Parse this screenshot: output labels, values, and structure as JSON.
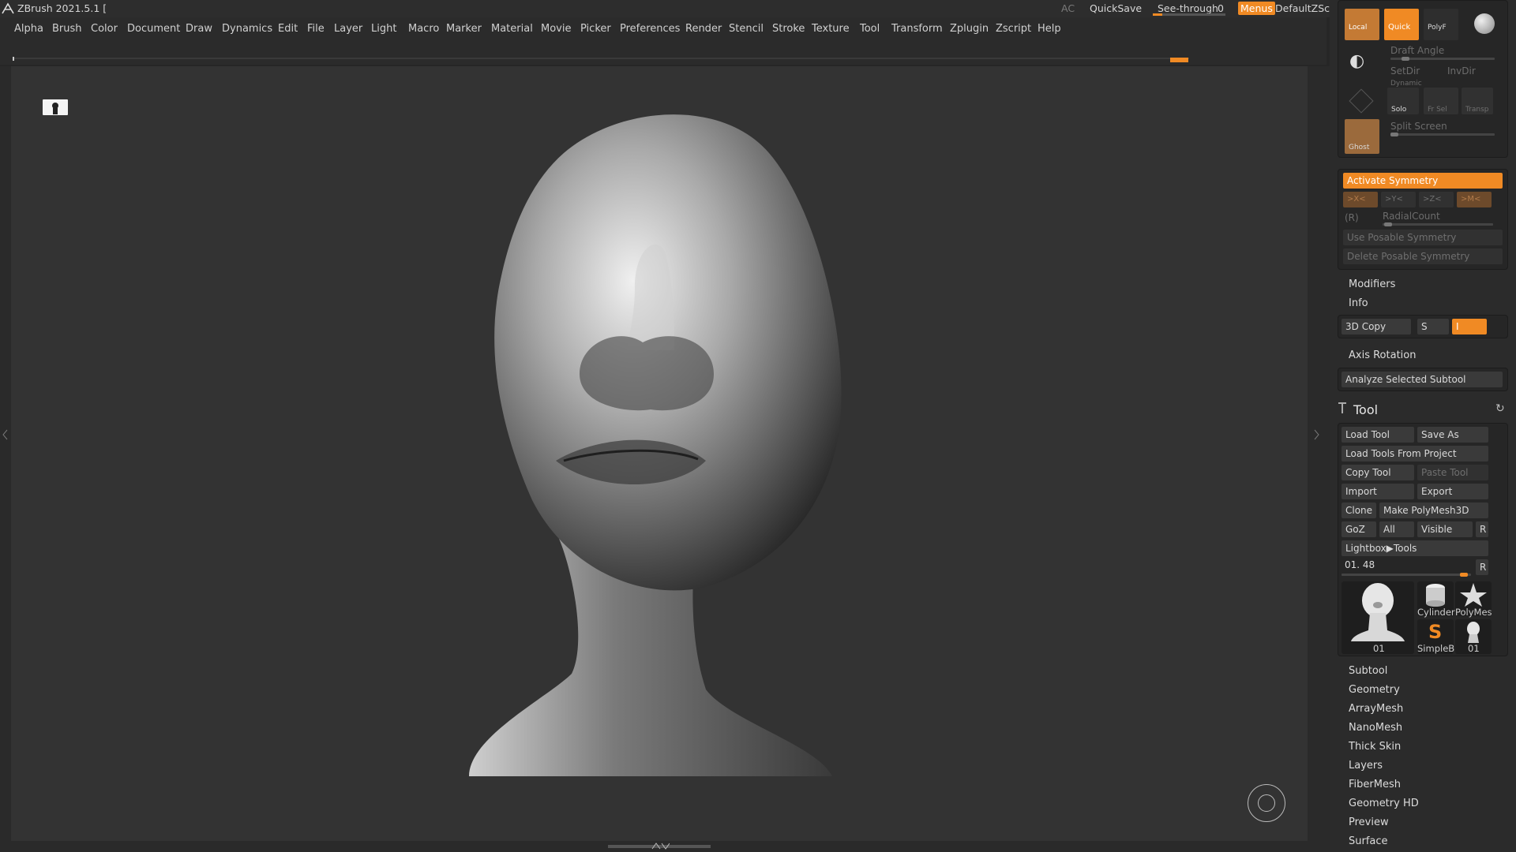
{
  "app": {
    "title": "ZBrush 2021.5.1 [",
    "ac": "AC",
    "quicksave": "QuickSave",
    "see_through_label": "See-through",
    "see_through_value": "0",
    "menus": "Menus",
    "script": "DefaultZScript"
  },
  "menu": [
    "Alpha",
    "Brush",
    "Color",
    "Document",
    "Draw",
    "Dynamics",
    "Edit",
    "File",
    "Layer",
    "Light",
    "Macro",
    "Marker",
    "Material",
    "Movie",
    "Picker",
    "Preferences",
    "Render",
    "Stencil",
    "Stroke",
    "Texture",
    "Tool",
    "Transform",
    "Zplugin",
    "Zscript",
    "Help"
  ],
  "top_buttons": {
    "local": "Local",
    "quick": "Quick",
    "polyf": "PolyF",
    "draft_angle": "Draft Angle",
    "setdir": "SetDir",
    "invdir": "InvDir",
    "dynamic": "Dynamic",
    "solo": "Solo",
    "frsel": "Fr Sel",
    "transp": "Transp",
    "split_screen": "Split Screen",
    "ghost": "Ghost"
  },
  "symmetry": {
    "activate": "Activate Symmetry",
    "x": ">X<",
    "y": ">Y<",
    "z": ">Z<",
    "m": ">M<",
    "r": "(R)",
    "radial": "RadialCount",
    "posable": "Use Posable Symmetry",
    "delete_posable": "Delete Posable Symmetry",
    "modifiers": "Modifiers",
    "info": "Info",
    "copy3d": "3D Copy",
    "s": "S",
    "i": "I",
    "axis_rotation": "Axis Rotation",
    "analyze": "Analyze Selected Subtool"
  },
  "tool": {
    "title": "Tool",
    "load_tool": "Load Tool",
    "save_as": "Save As",
    "load_from_project": "Load Tools From Project",
    "copy_tool": "Copy Tool",
    "paste_tool": "Paste Tool",
    "import": "Import",
    "export": "Export",
    "clone": "Clone",
    "make_polymesh": "Make PolyMesh3D",
    "goz": "GoZ",
    "all": "All",
    "visible": "Visible",
    "r": "R",
    "lightbox": "Lightbox▶Tools",
    "slider_value": "01. 48",
    "thumbs": {
      "main": "01",
      "cylinder": "Cylinder",
      "polymesh": "PolyMes",
      "simpleb": "SimpleB",
      "small": "01"
    }
  },
  "sections": [
    "Subtool",
    "Geometry",
    "ArrayMesh",
    "NanoMesh",
    "Thick Skin",
    "Layers",
    "FiberMesh",
    "Geometry HD",
    "Preview",
    "Surface"
  ],
  "colors": {
    "accent": "#f08a24"
  }
}
